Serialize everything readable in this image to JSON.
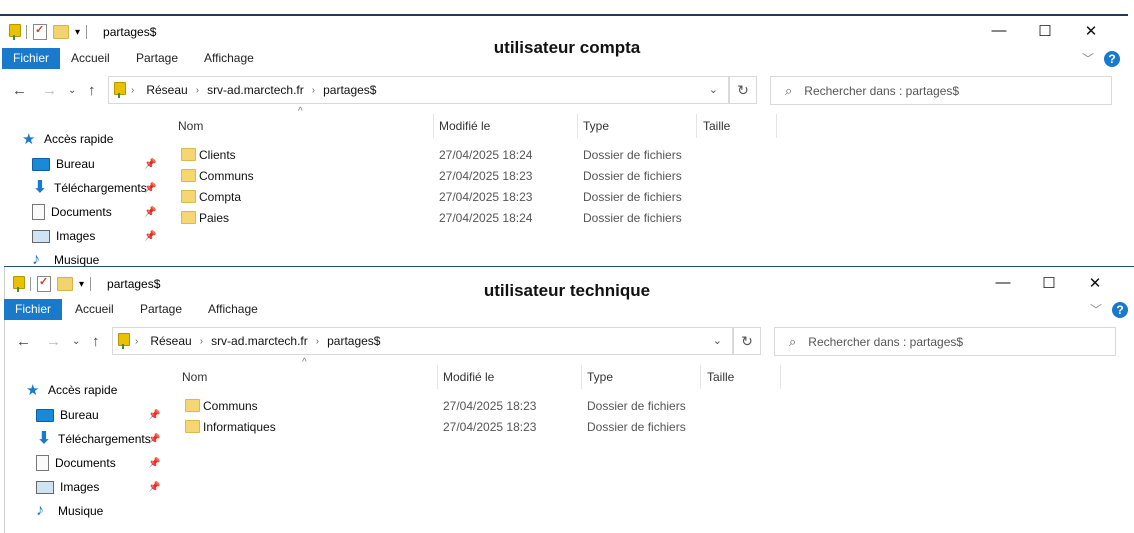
{
  "windows": [
    {
      "caption": "utilisateur compta",
      "title": "partages$",
      "ribbon_tabs": [
        "Fichier",
        "Accueil",
        "Partage",
        "Affichage"
      ],
      "breadcrumb": [
        "Réseau",
        "srv-ad.marctech.fr",
        "partages$"
      ],
      "search_placeholder": "Rechercher dans : partages$",
      "columns": [
        "Nom",
        "Modifié le",
        "Type",
        "Taille"
      ],
      "quick_access": "Accès rapide",
      "sidebar": [
        "Bureau",
        "Téléchargements",
        "Documents",
        "Images",
        "Musique"
      ],
      "rows": [
        {
          "name": "Clients",
          "modified": "27/04/2025 18:24",
          "type": "Dossier de fichiers"
        },
        {
          "name": "Communs",
          "modified": "27/04/2025 18:23",
          "type": "Dossier de fichiers"
        },
        {
          "name": "Compta",
          "modified": "27/04/2025 18:23",
          "type": "Dossier de fichiers"
        },
        {
          "name": "Paies",
          "modified": "27/04/2025 18:24",
          "type": "Dossier de fichiers"
        }
      ]
    },
    {
      "caption": "utilisateur technique",
      "title": "partages$",
      "ribbon_tabs": [
        "Fichier",
        "Accueil",
        "Partage",
        "Affichage"
      ],
      "breadcrumb": [
        "Réseau",
        "srv-ad.marctech.fr",
        "partages$"
      ],
      "search_placeholder": "Rechercher dans : partages$",
      "columns": [
        "Nom",
        "Modifié le",
        "Type",
        "Taille"
      ],
      "quick_access": "Accès rapide",
      "sidebar": [
        "Bureau",
        "Téléchargements",
        "Documents",
        "Images",
        "Musique"
      ],
      "rows": [
        {
          "name": "Communs",
          "modified": "27/04/2025 18:23",
          "type": "Dossier de fichiers"
        },
        {
          "name": "Informatiques",
          "modified": "27/04/2025 18:23",
          "type": "Dossier de fichiers"
        }
      ]
    }
  ],
  "colors": {
    "accent": "#1979ca",
    "folder": "#f5d673"
  }
}
